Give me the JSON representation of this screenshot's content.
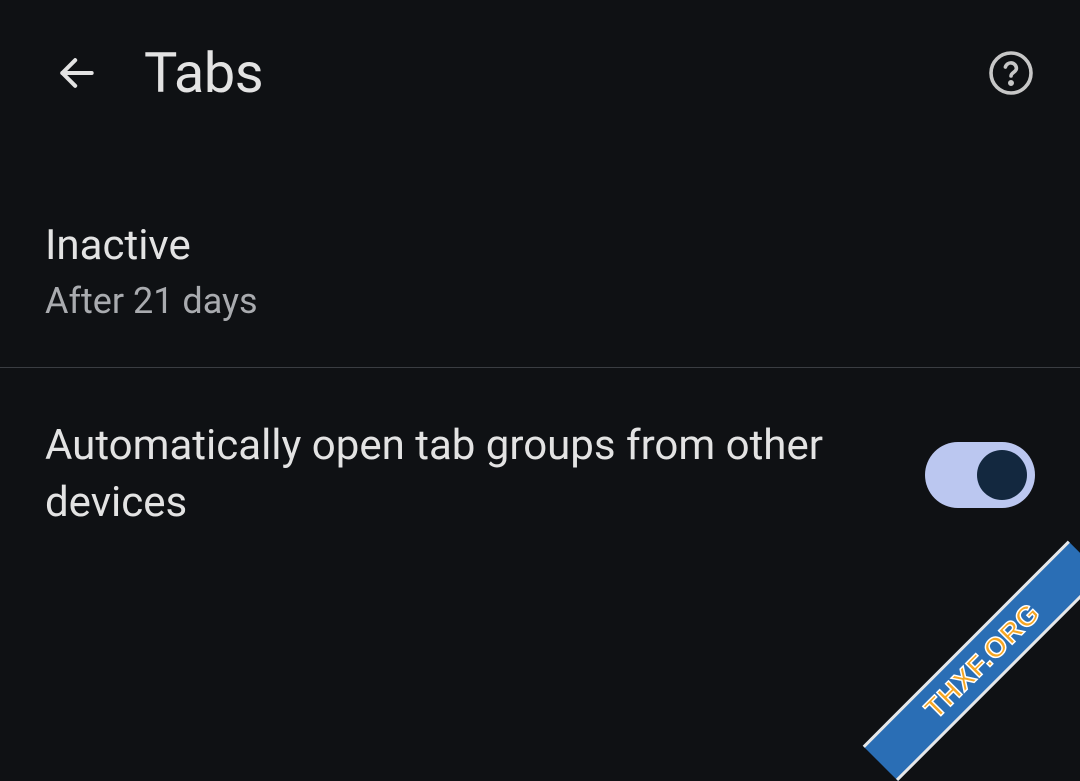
{
  "header": {
    "title": "Tabs"
  },
  "settings": {
    "inactive": {
      "title": "Inactive",
      "subtitle": "After 21 days"
    },
    "autoOpenTabGroups": {
      "label": "Automatically open tab groups from other devices",
      "enabled": true
    }
  },
  "watermark": {
    "text": "THXF.ORG"
  }
}
